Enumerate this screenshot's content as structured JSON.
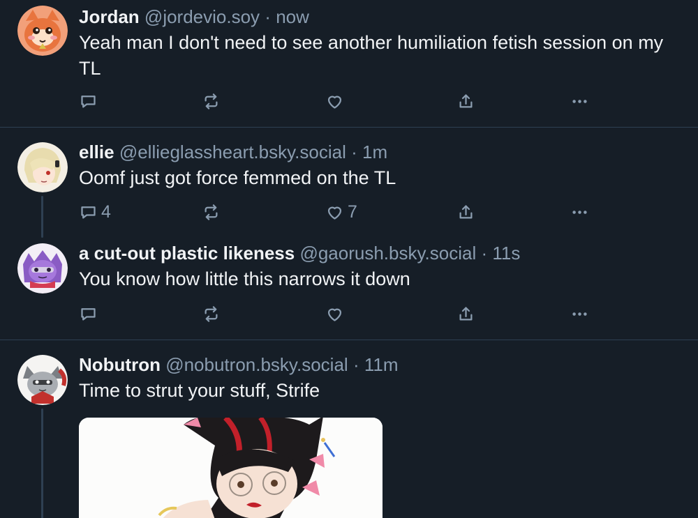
{
  "posts": [
    {
      "author": "Jordan",
      "handle": "@jordevio.soy",
      "separator": "·",
      "time": "now",
      "text": "Yeah man I don't need to see another humiliation fetish session on my TL",
      "replies": "",
      "likes": ""
    },
    {
      "author": "ellie",
      "handle": "@ellieglassheart.bsky.social",
      "separator": "·",
      "time": "1m",
      "text": "Oomf just got force femmed on the TL",
      "replies": "4",
      "likes": "7"
    },
    {
      "author": "a cut-out plastic likeness",
      "handle": "@gaorush.bsky.social",
      "separator": "·",
      "time": "11s",
      "text": "You know how little this narrows it down",
      "replies": "",
      "likes": ""
    },
    {
      "author": "Nobutron",
      "handle": "@nobutron.bsky.social",
      "separator": "·",
      "time": "11m",
      "text": "Time to strut your stuff, Strife"
    }
  ],
  "icons": {
    "reply": "reply-icon",
    "repost": "repost-icon",
    "like": "heart-icon",
    "share": "share-icon",
    "more": "more-options-icon"
  },
  "colors": {
    "background": "#161e27",
    "text": "#f1f3f5",
    "muted": "#8b9db0",
    "divider": "#2e4052"
  }
}
